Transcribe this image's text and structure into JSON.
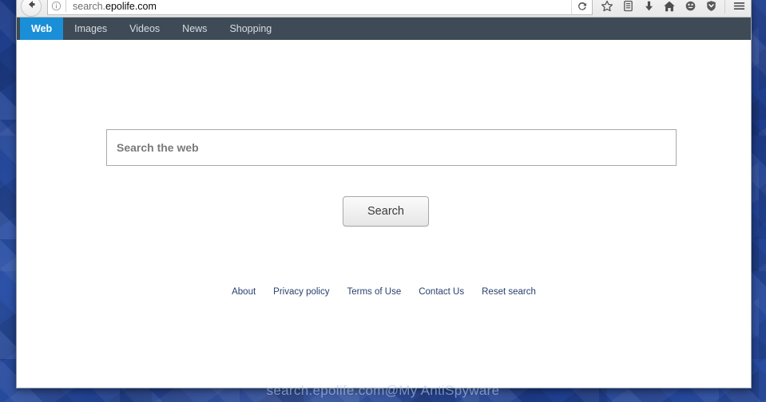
{
  "browser": {
    "back_icon": "back-arrow-icon",
    "identity_icon": "info-circle-icon",
    "url_prefix": "search.",
    "url_domain": "epolife.com",
    "url_full": "search.epolife.com",
    "reload_icon": "reload-icon",
    "toolbar_icons": [
      {
        "name": "bookmark-star-icon",
        "label": "Bookmark this page"
      },
      {
        "name": "library-icon",
        "label": "Library"
      },
      {
        "name": "downloads-icon",
        "label": "Downloads"
      },
      {
        "name": "home-icon",
        "label": "Home"
      },
      {
        "name": "pocket-smiley-icon",
        "label": "Pocket"
      },
      {
        "name": "shield-icon",
        "label": "Tracking protection"
      },
      {
        "name": "hamburger-menu-icon",
        "label": "Open menu"
      }
    ]
  },
  "site_nav": {
    "tabs": [
      {
        "label": "Web",
        "active": true
      },
      {
        "label": "Images",
        "active": false
      },
      {
        "label": "Videos",
        "active": false
      },
      {
        "label": "News",
        "active": false
      },
      {
        "label": "Shopping",
        "active": false
      }
    ],
    "active_background": "#1a8fd8",
    "background": "#3e4b56"
  },
  "search": {
    "placeholder": "Search the web",
    "value": "",
    "button_label": "Search"
  },
  "footer": {
    "links": [
      {
        "label": "About"
      },
      {
        "label": "Privacy policy"
      },
      {
        "label": "Terms of Use"
      },
      {
        "label": "Contact Us"
      },
      {
        "label": "Reset search"
      }
    ],
    "link_color": "#27406e"
  },
  "watermark": {
    "text": "search.epolife.com@My AntiSpyware"
  }
}
